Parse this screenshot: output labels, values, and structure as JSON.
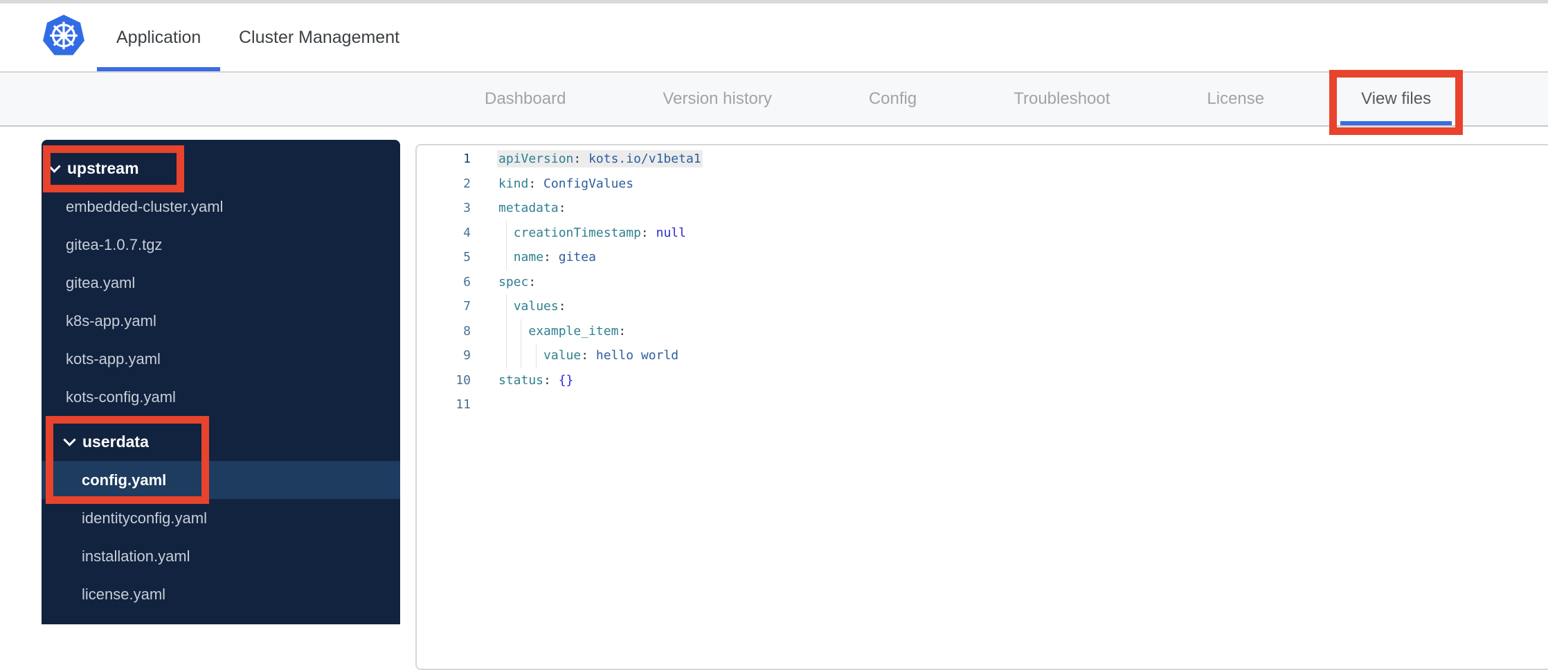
{
  "app": {
    "logo_icon": "kubernetes-logo"
  },
  "primary_nav": {
    "tabs": [
      {
        "label": "Application",
        "active": true
      },
      {
        "label": "Cluster Management",
        "active": false
      }
    ]
  },
  "secondary_nav": {
    "tabs": [
      {
        "label": "Dashboard",
        "active": false,
        "annotated": false
      },
      {
        "label": "Version history",
        "active": false,
        "annotated": false
      },
      {
        "label": "Config",
        "active": false,
        "annotated": false
      },
      {
        "label": "Troubleshoot",
        "active": false,
        "annotated": false
      },
      {
        "label": "License",
        "active": false,
        "annotated": false
      },
      {
        "label": "View files",
        "active": true,
        "annotated": true
      }
    ]
  },
  "file_tree": {
    "items": [
      {
        "label": "upstream",
        "type": "folder",
        "level": 0,
        "expanded": true,
        "annotated": true
      },
      {
        "label": "embedded-cluster.yaml",
        "type": "file",
        "level": 1
      },
      {
        "label": "gitea-1.0.7.tgz",
        "type": "file",
        "level": 1
      },
      {
        "label": "gitea.yaml",
        "type": "file",
        "level": 1
      },
      {
        "label": "k8s-app.yaml",
        "type": "file",
        "level": 1
      },
      {
        "label": "kots-app.yaml",
        "type": "file",
        "level": 1
      },
      {
        "label": "kots-config.yaml",
        "type": "file",
        "level": 1
      },
      {
        "label": "userdata",
        "type": "folder",
        "level": 1,
        "expanded": true,
        "annotated": true,
        "gap_above": true
      },
      {
        "label": "config.yaml",
        "type": "file",
        "level": 2,
        "selected": true,
        "annotated": true
      },
      {
        "label": "identityconfig.yaml",
        "type": "file",
        "level": 2
      },
      {
        "label": "installation.yaml",
        "type": "file",
        "level": 2
      },
      {
        "label": "license.yaml",
        "type": "file",
        "level": 2
      }
    ]
  },
  "editor": {
    "file": "config.yaml",
    "lines": [
      {
        "num": "1",
        "active": true,
        "guides": 0,
        "tokens": [
          {
            "text": "apiVersion",
            "type": "key"
          },
          {
            "text": ": ",
            "type": "punct"
          },
          {
            "text": "kots.io/v1beta1",
            "type": "value"
          }
        ]
      },
      {
        "num": "2",
        "active": false,
        "guides": 0,
        "tokens": [
          {
            "text": "kind",
            "type": "key"
          },
          {
            "text": ": ",
            "type": "punct"
          },
          {
            "text": "ConfigValues",
            "type": "value"
          }
        ]
      },
      {
        "num": "3",
        "active": false,
        "guides": 0,
        "tokens": [
          {
            "text": "metadata",
            "type": "key"
          },
          {
            "text": ":",
            "type": "punct"
          }
        ]
      },
      {
        "num": "4",
        "active": false,
        "guides": 1,
        "tokens": [
          {
            "text": "  ",
            "type": "punct"
          },
          {
            "text": "creationTimestamp",
            "type": "key"
          },
          {
            "text": ": ",
            "type": "punct"
          },
          {
            "text": "null",
            "type": "literal"
          }
        ]
      },
      {
        "num": "5",
        "active": false,
        "guides": 1,
        "tokens": [
          {
            "text": "  ",
            "type": "punct"
          },
          {
            "text": "name",
            "type": "key"
          },
          {
            "text": ": ",
            "type": "punct"
          },
          {
            "text": "gitea",
            "type": "value"
          }
        ]
      },
      {
        "num": "6",
        "active": false,
        "guides": 0,
        "tokens": [
          {
            "text": "spec",
            "type": "key"
          },
          {
            "text": ":",
            "type": "punct"
          }
        ]
      },
      {
        "num": "7",
        "active": false,
        "guides": 1,
        "tokens": [
          {
            "text": "  ",
            "type": "punct"
          },
          {
            "text": "values",
            "type": "key"
          },
          {
            "text": ":",
            "type": "punct"
          }
        ]
      },
      {
        "num": "8",
        "active": false,
        "guides": 2,
        "tokens": [
          {
            "text": "    ",
            "type": "punct"
          },
          {
            "text": "example_item",
            "type": "key"
          },
          {
            "text": ":",
            "type": "punct"
          }
        ]
      },
      {
        "num": "9",
        "active": false,
        "guides": 3,
        "tokens": [
          {
            "text": "      ",
            "type": "punct"
          },
          {
            "text": "value",
            "type": "key"
          },
          {
            "text": ": ",
            "type": "punct"
          },
          {
            "text": "hello world",
            "type": "value"
          }
        ]
      },
      {
        "num": "10",
        "active": false,
        "guides": 0,
        "tokens": [
          {
            "text": "status",
            "type": "key"
          },
          {
            "text": ": ",
            "type": "punct"
          },
          {
            "text": "{}",
            "type": "literal"
          }
        ]
      },
      {
        "num": "11",
        "active": false,
        "guides": 0,
        "tokens": []
      }
    ]
  },
  "annotations": {
    "color": "#e8432d",
    "targets": [
      "View files tab",
      "upstream folder",
      "userdata folder and config.yaml file"
    ]
  },
  "colors": {
    "accent_blue": "#3b6ce4",
    "kubernetes_blue": "#326ce5",
    "sidebar_background": "#12233f",
    "sidebar_selected_row": "#1e3b60",
    "code_key": "#2f7f90",
    "code_value": "#2d5e9e",
    "code_literal": "#2a2ad4"
  }
}
